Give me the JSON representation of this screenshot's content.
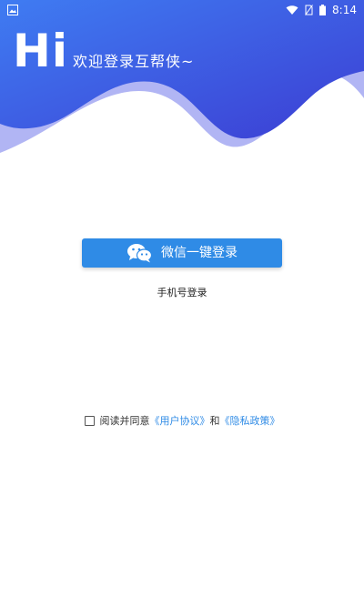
{
  "status_bar": {
    "time": "8:14"
  },
  "header": {
    "hi": "Hi",
    "welcome": "欢迎登录互帮侠~"
  },
  "login": {
    "wechat_label": "微信一键登录",
    "phone_label": "手机号登录"
  },
  "agreement": {
    "prefix": "阅读并同意",
    "user_agreement": "《用户协议》",
    "conjunction": "和",
    "privacy_policy": "《隐私政策》"
  },
  "colors": {
    "header_gradient_start": "#3e6df0",
    "header_gradient_end": "#3f3fd6",
    "wave_light": "#9aa2f0",
    "button": "#2f8be6",
    "link": "#2f8be6"
  }
}
